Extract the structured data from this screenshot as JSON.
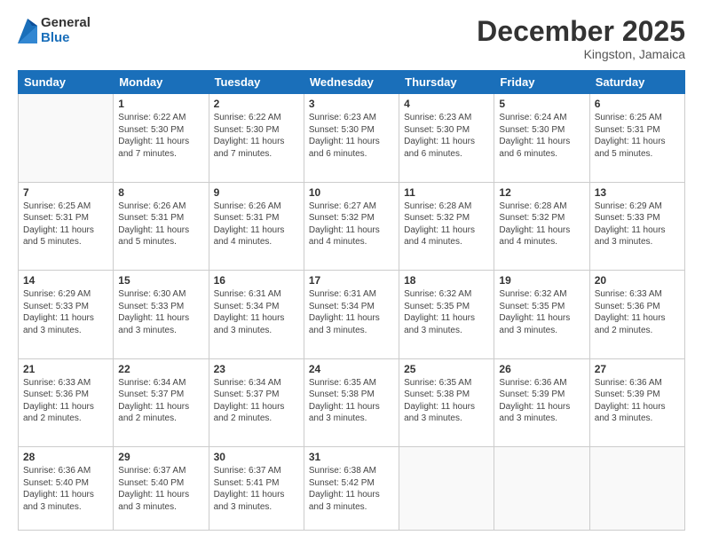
{
  "header": {
    "logo": {
      "general": "General",
      "blue": "Blue"
    },
    "title": "December 2025",
    "location": "Kingston, Jamaica"
  },
  "weekdays": [
    "Sunday",
    "Monday",
    "Tuesday",
    "Wednesday",
    "Thursday",
    "Friday",
    "Saturday"
  ],
  "weeks": [
    [
      {
        "day": "",
        "sunrise": "",
        "sunset": "",
        "daylight": ""
      },
      {
        "day": "1",
        "sunrise": "Sunrise: 6:22 AM",
        "sunset": "Sunset: 5:30 PM",
        "daylight": "Daylight: 11 hours and 7 minutes."
      },
      {
        "day": "2",
        "sunrise": "Sunrise: 6:22 AM",
        "sunset": "Sunset: 5:30 PM",
        "daylight": "Daylight: 11 hours and 7 minutes."
      },
      {
        "day": "3",
        "sunrise": "Sunrise: 6:23 AM",
        "sunset": "Sunset: 5:30 PM",
        "daylight": "Daylight: 11 hours and 6 minutes."
      },
      {
        "day": "4",
        "sunrise": "Sunrise: 6:23 AM",
        "sunset": "Sunset: 5:30 PM",
        "daylight": "Daylight: 11 hours and 6 minutes."
      },
      {
        "day": "5",
        "sunrise": "Sunrise: 6:24 AM",
        "sunset": "Sunset: 5:30 PM",
        "daylight": "Daylight: 11 hours and 6 minutes."
      },
      {
        "day": "6",
        "sunrise": "Sunrise: 6:25 AM",
        "sunset": "Sunset: 5:31 PM",
        "daylight": "Daylight: 11 hours and 5 minutes."
      }
    ],
    [
      {
        "day": "7",
        "sunrise": "Sunrise: 6:25 AM",
        "sunset": "Sunset: 5:31 PM",
        "daylight": "Daylight: 11 hours and 5 minutes."
      },
      {
        "day": "8",
        "sunrise": "Sunrise: 6:26 AM",
        "sunset": "Sunset: 5:31 PM",
        "daylight": "Daylight: 11 hours and 5 minutes."
      },
      {
        "day": "9",
        "sunrise": "Sunrise: 6:26 AM",
        "sunset": "Sunset: 5:31 PM",
        "daylight": "Daylight: 11 hours and 4 minutes."
      },
      {
        "day": "10",
        "sunrise": "Sunrise: 6:27 AM",
        "sunset": "Sunset: 5:32 PM",
        "daylight": "Daylight: 11 hours and 4 minutes."
      },
      {
        "day": "11",
        "sunrise": "Sunrise: 6:28 AM",
        "sunset": "Sunset: 5:32 PM",
        "daylight": "Daylight: 11 hours and 4 minutes."
      },
      {
        "day": "12",
        "sunrise": "Sunrise: 6:28 AM",
        "sunset": "Sunset: 5:32 PM",
        "daylight": "Daylight: 11 hours and 4 minutes."
      },
      {
        "day": "13",
        "sunrise": "Sunrise: 6:29 AM",
        "sunset": "Sunset: 5:33 PM",
        "daylight": "Daylight: 11 hours and 3 minutes."
      }
    ],
    [
      {
        "day": "14",
        "sunrise": "Sunrise: 6:29 AM",
        "sunset": "Sunset: 5:33 PM",
        "daylight": "Daylight: 11 hours and 3 minutes."
      },
      {
        "day": "15",
        "sunrise": "Sunrise: 6:30 AM",
        "sunset": "Sunset: 5:33 PM",
        "daylight": "Daylight: 11 hours and 3 minutes."
      },
      {
        "day": "16",
        "sunrise": "Sunrise: 6:31 AM",
        "sunset": "Sunset: 5:34 PM",
        "daylight": "Daylight: 11 hours and 3 minutes."
      },
      {
        "day": "17",
        "sunrise": "Sunrise: 6:31 AM",
        "sunset": "Sunset: 5:34 PM",
        "daylight": "Daylight: 11 hours and 3 minutes."
      },
      {
        "day": "18",
        "sunrise": "Sunrise: 6:32 AM",
        "sunset": "Sunset: 5:35 PM",
        "daylight": "Daylight: 11 hours and 3 minutes."
      },
      {
        "day": "19",
        "sunrise": "Sunrise: 6:32 AM",
        "sunset": "Sunset: 5:35 PM",
        "daylight": "Daylight: 11 hours and 3 minutes."
      },
      {
        "day": "20",
        "sunrise": "Sunrise: 6:33 AM",
        "sunset": "Sunset: 5:36 PM",
        "daylight": "Daylight: 11 hours and 2 minutes."
      }
    ],
    [
      {
        "day": "21",
        "sunrise": "Sunrise: 6:33 AM",
        "sunset": "Sunset: 5:36 PM",
        "daylight": "Daylight: 11 hours and 2 minutes."
      },
      {
        "day": "22",
        "sunrise": "Sunrise: 6:34 AM",
        "sunset": "Sunset: 5:37 PM",
        "daylight": "Daylight: 11 hours and 2 minutes."
      },
      {
        "day": "23",
        "sunrise": "Sunrise: 6:34 AM",
        "sunset": "Sunset: 5:37 PM",
        "daylight": "Daylight: 11 hours and 2 minutes."
      },
      {
        "day": "24",
        "sunrise": "Sunrise: 6:35 AM",
        "sunset": "Sunset: 5:38 PM",
        "daylight": "Daylight: 11 hours and 3 minutes."
      },
      {
        "day": "25",
        "sunrise": "Sunrise: 6:35 AM",
        "sunset": "Sunset: 5:38 PM",
        "daylight": "Daylight: 11 hours and 3 minutes."
      },
      {
        "day": "26",
        "sunrise": "Sunrise: 6:36 AM",
        "sunset": "Sunset: 5:39 PM",
        "daylight": "Daylight: 11 hours and 3 minutes."
      },
      {
        "day": "27",
        "sunrise": "Sunrise: 6:36 AM",
        "sunset": "Sunset: 5:39 PM",
        "daylight": "Daylight: 11 hours and 3 minutes."
      }
    ],
    [
      {
        "day": "28",
        "sunrise": "Sunrise: 6:36 AM",
        "sunset": "Sunset: 5:40 PM",
        "daylight": "Daylight: 11 hours and 3 minutes."
      },
      {
        "day": "29",
        "sunrise": "Sunrise: 6:37 AM",
        "sunset": "Sunset: 5:40 PM",
        "daylight": "Daylight: 11 hours and 3 minutes."
      },
      {
        "day": "30",
        "sunrise": "Sunrise: 6:37 AM",
        "sunset": "Sunset: 5:41 PM",
        "daylight": "Daylight: 11 hours and 3 minutes."
      },
      {
        "day": "31",
        "sunrise": "Sunrise: 6:38 AM",
        "sunset": "Sunset: 5:42 PM",
        "daylight": "Daylight: 11 hours and 3 minutes."
      },
      {
        "day": "",
        "sunrise": "",
        "sunset": "",
        "daylight": ""
      },
      {
        "day": "",
        "sunrise": "",
        "sunset": "",
        "daylight": ""
      },
      {
        "day": "",
        "sunrise": "",
        "sunset": "",
        "daylight": ""
      }
    ]
  ]
}
